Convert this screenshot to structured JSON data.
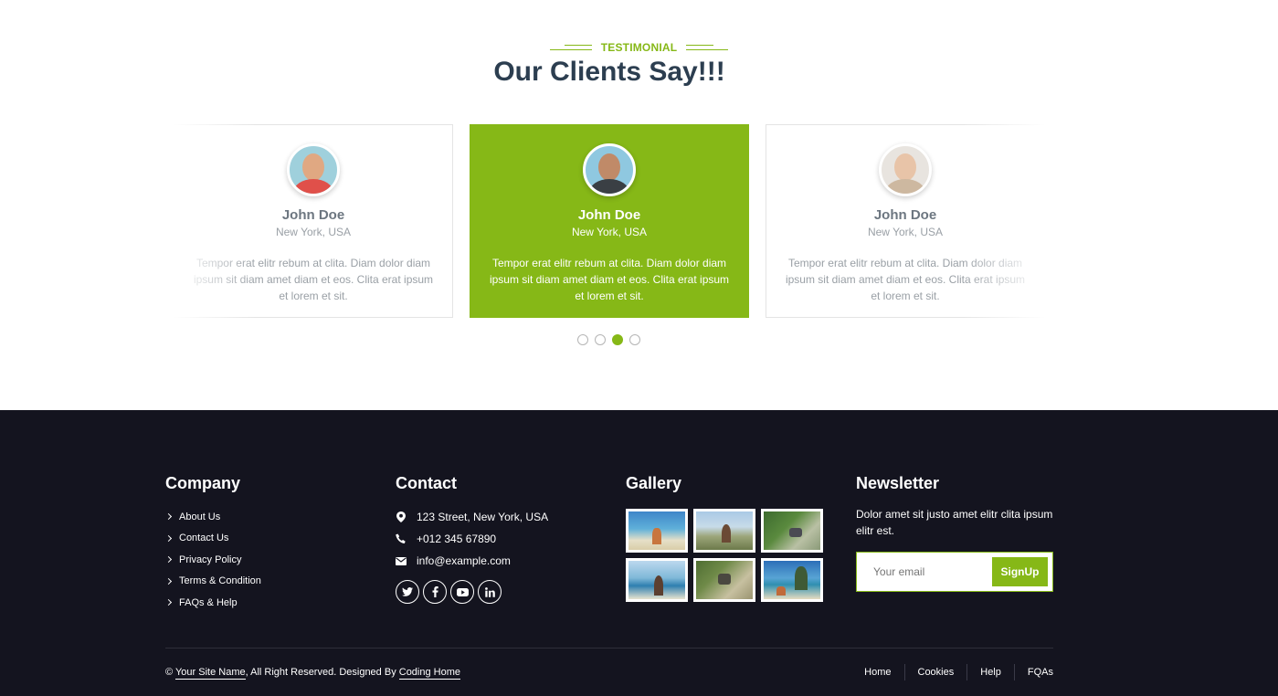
{
  "testimonial": {
    "eyebrow": "TESTIMONIAL",
    "heading": "Our Clients Say!!!",
    "cards": [
      {
        "name": "John Doe",
        "location": "New York, USA",
        "quote": "Tempor erat elitr rebum at clita. Diam dolor diam ipsum sit diam amet diam et eos. Clita erat ipsum et lorem et sit."
      },
      {
        "name": "John Doe",
        "location": "New York, USA",
        "quote": "Tempor erat elitr rebum at clita. Diam dolor diam ipsum sit diam amet diam et eos. Clita erat ipsum et lorem et sit."
      },
      {
        "name": "John Doe",
        "location": "New York, USA",
        "quote": "Tempor erat elitr rebum at clita. Diam dolor diam ipsum sit diam amet diam et eos. Clita erat ipsum et lorem et sit."
      }
    ],
    "active_dot": 3,
    "dot_count": 4
  },
  "footer": {
    "company": {
      "title": "Company",
      "links": [
        "About Us",
        "Contact Us",
        "Privacy Policy",
        "Terms & Condition",
        "FAQs & Help"
      ]
    },
    "contact": {
      "title": "Contact",
      "address": "123 Street, New York, USA",
      "phone": "+012 345 67890",
      "email": "info@example.com",
      "socials": [
        "twitter-icon",
        "facebook-icon",
        "youtube-icon",
        "linkedin-icon"
      ]
    },
    "gallery": {
      "title": "Gallery"
    },
    "newsletter": {
      "title": "Newsletter",
      "text": "Dolor amet sit justo amet elitr clita ipsum elitr est.",
      "placeholder": "Your email",
      "button": "SignUp"
    },
    "copyright": {
      "prefix": "© ",
      "site_name": "Your Site Name",
      "middle": ", All Right Reserved. Designed By ",
      "designer": "Coding Home"
    },
    "bottom_nav": [
      "Home",
      "Cookies",
      "Help",
      "FQAs"
    ]
  },
  "colors": {
    "accent": "#86b817",
    "footer_bg": "#14141f",
    "heading": "#2c3e50"
  }
}
